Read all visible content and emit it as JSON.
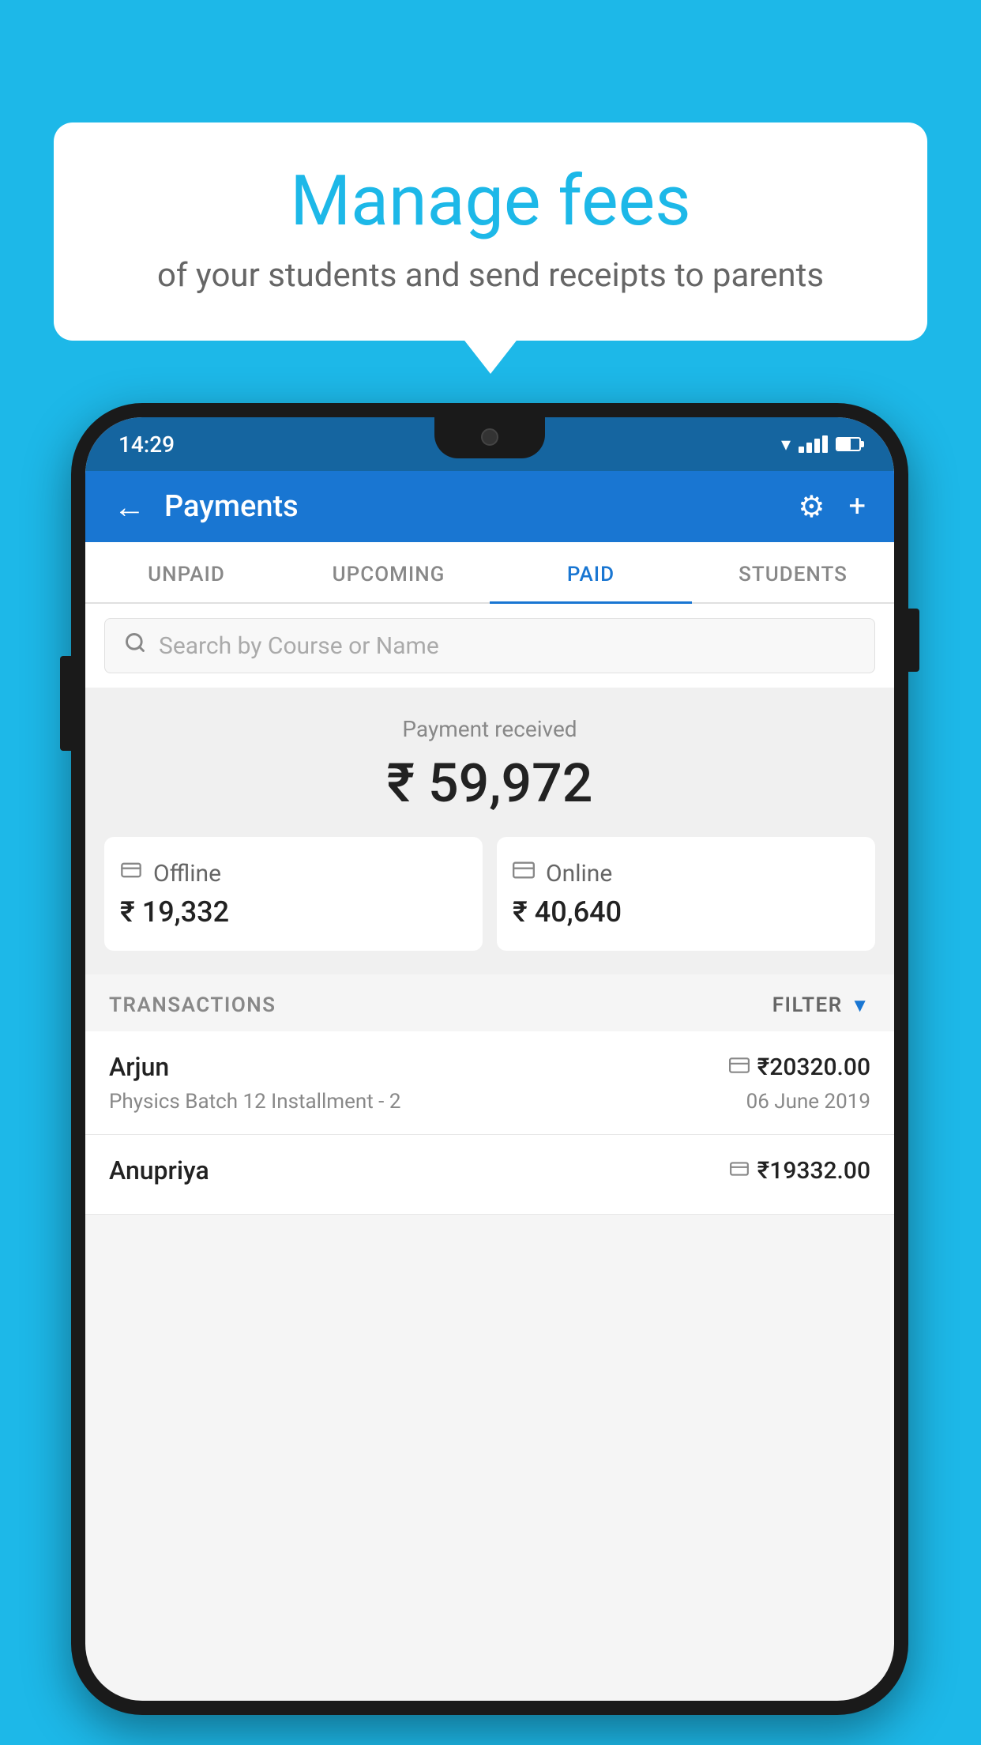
{
  "background_color": "#1DB8E8",
  "bubble": {
    "title": "Manage fees",
    "subtitle": "of your students and send receipts to parents"
  },
  "status_bar": {
    "time": "14:29"
  },
  "header": {
    "title": "Payments",
    "back_label": "←",
    "settings_label": "⚙",
    "add_label": "+"
  },
  "tabs": [
    {
      "label": "UNPAID",
      "active": false
    },
    {
      "label": "UPCOMING",
      "active": false
    },
    {
      "label": "PAID",
      "active": true
    },
    {
      "label": "STUDENTS",
      "active": false
    }
  ],
  "search": {
    "placeholder": "Search by Course or Name"
  },
  "payment_summary": {
    "received_label": "Payment received",
    "total_amount": "₹ 59,972",
    "offline_label": "Offline",
    "offline_amount": "₹ 19,332",
    "online_label": "Online",
    "online_amount": "₹ 40,640"
  },
  "transactions": {
    "section_label": "TRANSACTIONS",
    "filter_label": "FILTER",
    "items": [
      {
        "name": "Arjun",
        "course": "Physics Batch 12 Installment - 2",
        "amount": "₹20320.00",
        "date": "06 June 2019",
        "pay_type": "online"
      },
      {
        "name": "Anupriya",
        "course": "",
        "amount": "₹19332.00",
        "date": "",
        "pay_type": "offline"
      }
    ]
  }
}
